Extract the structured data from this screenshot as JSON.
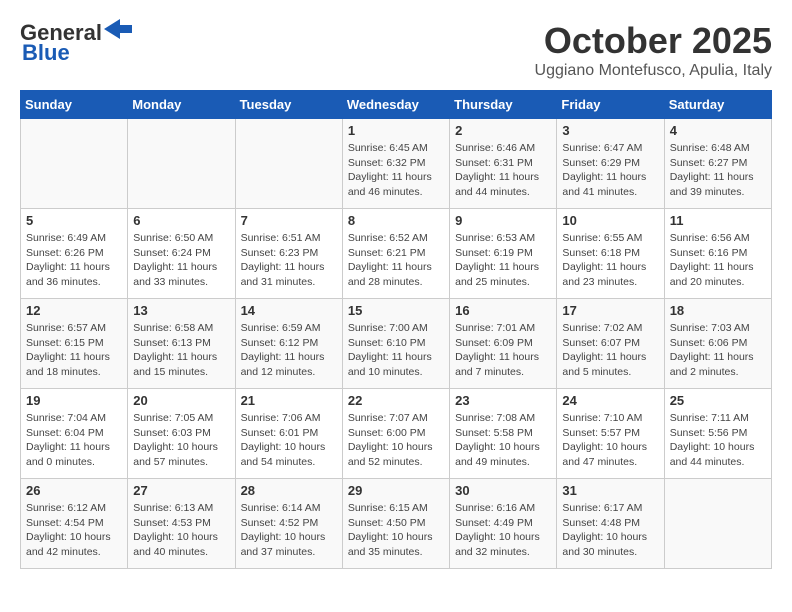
{
  "header": {
    "logo_general": "General",
    "logo_blue": "Blue",
    "month_title": "October 2025",
    "location": "Uggiano Montefusco, Apulia, Italy"
  },
  "weekdays": [
    "Sunday",
    "Monday",
    "Tuesday",
    "Wednesday",
    "Thursday",
    "Friday",
    "Saturday"
  ],
  "weeks": [
    [
      {
        "day": "",
        "info": ""
      },
      {
        "day": "",
        "info": ""
      },
      {
        "day": "",
        "info": ""
      },
      {
        "day": "1",
        "info": "Sunrise: 6:45 AM\nSunset: 6:32 PM\nDaylight: 11 hours and 46 minutes."
      },
      {
        "day": "2",
        "info": "Sunrise: 6:46 AM\nSunset: 6:31 PM\nDaylight: 11 hours and 44 minutes."
      },
      {
        "day": "3",
        "info": "Sunrise: 6:47 AM\nSunset: 6:29 PM\nDaylight: 11 hours and 41 minutes."
      },
      {
        "day": "4",
        "info": "Sunrise: 6:48 AM\nSunset: 6:27 PM\nDaylight: 11 hours and 39 minutes."
      }
    ],
    [
      {
        "day": "5",
        "info": "Sunrise: 6:49 AM\nSunset: 6:26 PM\nDaylight: 11 hours and 36 minutes."
      },
      {
        "day": "6",
        "info": "Sunrise: 6:50 AM\nSunset: 6:24 PM\nDaylight: 11 hours and 33 minutes."
      },
      {
        "day": "7",
        "info": "Sunrise: 6:51 AM\nSunset: 6:23 PM\nDaylight: 11 hours and 31 minutes."
      },
      {
        "day": "8",
        "info": "Sunrise: 6:52 AM\nSunset: 6:21 PM\nDaylight: 11 hours and 28 minutes."
      },
      {
        "day": "9",
        "info": "Sunrise: 6:53 AM\nSunset: 6:19 PM\nDaylight: 11 hours and 25 minutes."
      },
      {
        "day": "10",
        "info": "Sunrise: 6:55 AM\nSunset: 6:18 PM\nDaylight: 11 hours and 23 minutes."
      },
      {
        "day": "11",
        "info": "Sunrise: 6:56 AM\nSunset: 6:16 PM\nDaylight: 11 hours and 20 minutes."
      }
    ],
    [
      {
        "day": "12",
        "info": "Sunrise: 6:57 AM\nSunset: 6:15 PM\nDaylight: 11 hours and 18 minutes."
      },
      {
        "day": "13",
        "info": "Sunrise: 6:58 AM\nSunset: 6:13 PM\nDaylight: 11 hours and 15 minutes."
      },
      {
        "day": "14",
        "info": "Sunrise: 6:59 AM\nSunset: 6:12 PM\nDaylight: 11 hours and 12 minutes."
      },
      {
        "day": "15",
        "info": "Sunrise: 7:00 AM\nSunset: 6:10 PM\nDaylight: 11 hours and 10 minutes."
      },
      {
        "day": "16",
        "info": "Sunrise: 7:01 AM\nSunset: 6:09 PM\nDaylight: 11 hours and 7 minutes."
      },
      {
        "day": "17",
        "info": "Sunrise: 7:02 AM\nSunset: 6:07 PM\nDaylight: 11 hours and 5 minutes."
      },
      {
        "day": "18",
        "info": "Sunrise: 7:03 AM\nSunset: 6:06 PM\nDaylight: 11 hours and 2 minutes."
      }
    ],
    [
      {
        "day": "19",
        "info": "Sunrise: 7:04 AM\nSunset: 6:04 PM\nDaylight: 11 hours and 0 minutes."
      },
      {
        "day": "20",
        "info": "Sunrise: 7:05 AM\nSunset: 6:03 PM\nDaylight: 10 hours and 57 minutes."
      },
      {
        "day": "21",
        "info": "Sunrise: 7:06 AM\nSunset: 6:01 PM\nDaylight: 10 hours and 54 minutes."
      },
      {
        "day": "22",
        "info": "Sunrise: 7:07 AM\nSunset: 6:00 PM\nDaylight: 10 hours and 52 minutes."
      },
      {
        "day": "23",
        "info": "Sunrise: 7:08 AM\nSunset: 5:58 PM\nDaylight: 10 hours and 49 minutes."
      },
      {
        "day": "24",
        "info": "Sunrise: 7:10 AM\nSunset: 5:57 PM\nDaylight: 10 hours and 47 minutes."
      },
      {
        "day": "25",
        "info": "Sunrise: 7:11 AM\nSunset: 5:56 PM\nDaylight: 10 hours and 44 minutes."
      }
    ],
    [
      {
        "day": "26",
        "info": "Sunrise: 6:12 AM\nSunset: 4:54 PM\nDaylight: 10 hours and 42 minutes."
      },
      {
        "day": "27",
        "info": "Sunrise: 6:13 AM\nSunset: 4:53 PM\nDaylight: 10 hours and 40 minutes."
      },
      {
        "day": "28",
        "info": "Sunrise: 6:14 AM\nSunset: 4:52 PM\nDaylight: 10 hours and 37 minutes."
      },
      {
        "day": "29",
        "info": "Sunrise: 6:15 AM\nSunset: 4:50 PM\nDaylight: 10 hours and 35 minutes."
      },
      {
        "day": "30",
        "info": "Sunrise: 6:16 AM\nSunset: 4:49 PM\nDaylight: 10 hours and 32 minutes."
      },
      {
        "day": "31",
        "info": "Sunrise: 6:17 AM\nSunset: 4:48 PM\nDaylight: 10 hours and 30 minutes."
      },
      {
        "day": "",
        "info": ""
      }
    ]
  ]
}
